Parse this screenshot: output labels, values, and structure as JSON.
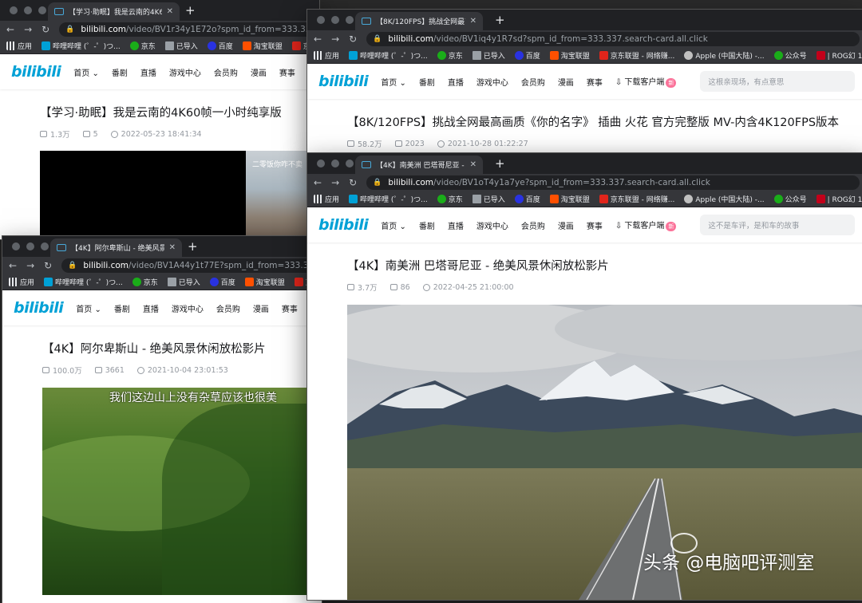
{
  "windows": [
    {
      "tab_title": "【学习·助眠】我是云南的4K60",
      "url_domain": "bilibili.com",
      "url_rest": "/video/BV1r34y1E72o?spm_id_from=333.337.search-c",
      "video_title": "【学习·助眠】我是云南的4K60帧一小时纯享版",
      "views": "1.3万",
      "danmaku": "5",
      "date": "2022-05-23 18:41:34",
      "subtitle": "二零饭你咋不卖"
    },
    {
      "tab_title": "【4K】阿尔卑斯山 - 绝美风景休",
      "url_domain": "bilibili.com",
      "url_rest": "/video/BV1A44y1t77E?spm_id_from=333.337.search-",
      "video_title": "【4K】阿尔卑斯山 - 绝美风景休闲放松影片",
      "views": "100.0万",
      "danmaku": "3661",
      "date": "2021-10-04 23:01:53",
      "subtitle": "我们这边山上没有杂草应该也很美"
    },
    {
      "tab_title": "【8K/120FPS】挑战全网最高画",
      "url_domain": "bilibili.com",
      "url_rest": "/video/BV1iq4y1R7sd?spm_id_from=333.337.search-card.all.click",
      "video_title": "【8K/120FPS】挑战全网最高画质《你的名字》 插曲 火花 官方完整版 MV-内含4K120FPS版本",
      "views": "58.2万",
      "danmaku": "2023",
      "date": "2021-10-28 01:22:27",
      "search_placeholder": "这根亲现场，有点意思"
    },
    {
      "tab_title": "【4K】南美洲 巴塔哥尼亚 - 绝美",
      "url_domain": "bilibili.com",
      "url_rest": "/video/BV1oT4y1a7ye?spm_id_from=333.337.search-card.all.click",
      "video_title": "【4K】南美洲 巴塔哥尼亚 - 绝美风景休闲放松影片",
      "views": "3.7万",
      "danmaku": "86",
      "date": "2022-04-25 21:00:00",
      "search_placeholder": "这不是车评，是和车的故事"
    }
  ],
  "bookmarks": [
    "应用",
    "哔哩哔哩 (゜-゜)つ...",
    "京东",
    "已导入",
    "百度",
    "淘宝联盟",
    "京东联盟 - 网络赚...",
    "Apple (中国大陆) -...",
    "公众号",
    "| ROG幻 16 | 电竞..."
  ],
  "bilibili": {
    "logo": "bilibili",
    "nav": [
      "首页",
      "番剧",
      "直播",
      "游戏中心",
      "会员购",
      "漫画",
      "赛事",
      "下载客户端"
    ],
    "dl_badge": "新"
  },
  "watermark": "头条 @电脑吧评测室"
}
